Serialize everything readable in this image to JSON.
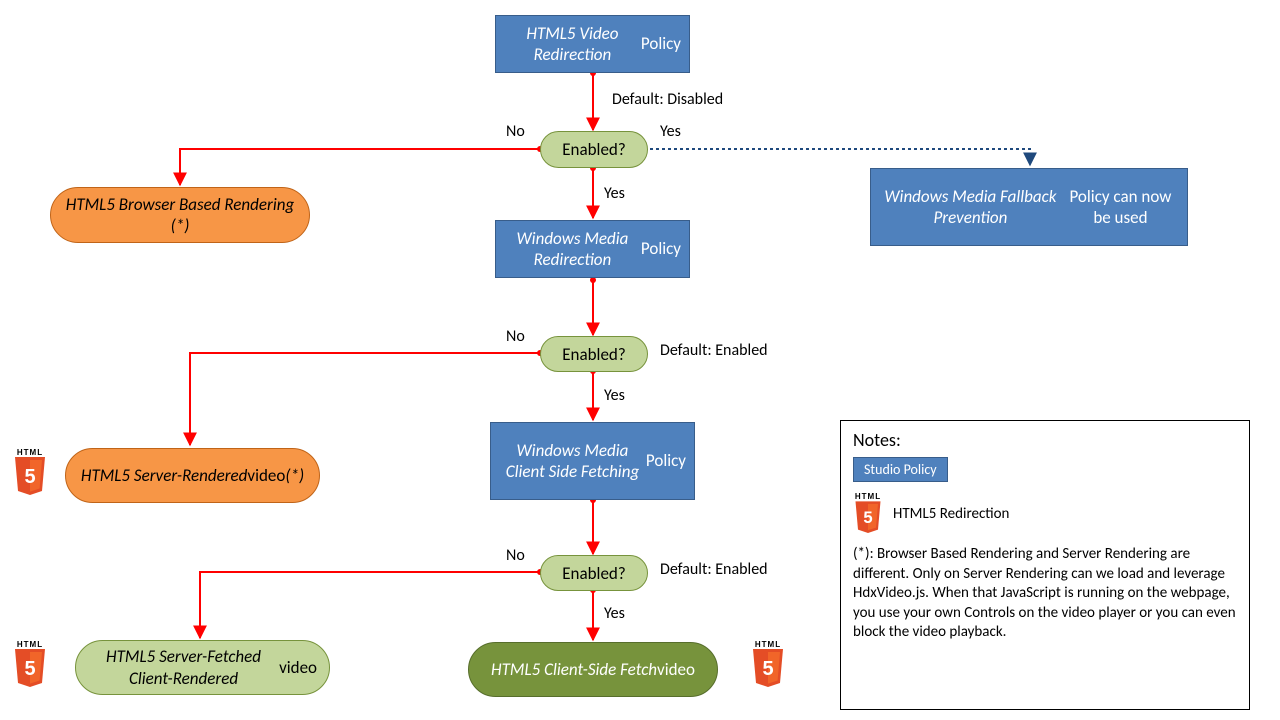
{
  "nodes": {
    "policy1_html": "<span class='em'>HTML5 Video Redirection</span> Policy",
    "policy2_html": "<span class='em'>Windows Media Redirection</span> Policy",
    "policy3_html": "<span class='em'>Windows Media Client Side Fetching</span> Policy",
    "fallback_html": "<span class='em'>Windows Media Fallback Prevention</span> Policy can now be used",
    "decision": "Enabled?",
    "outcome_orange1": "HTML5 Browser Based Rendering (*)",
    "outcome_orange2_html": "HTML5 Server-Rendered <span class='normal'>video</span> (*)",
    "outcome_lime_html": "HTML5 Server-Fetched Client-Rendered <span class='normal'>video</span>",
    "outcome_green_html": "HTML5 Client-Side Fetch <span class='normal'>video</span>"
  },
  "labels": {
    "default_disabled": "Default: Disabled",
    "default_enabled": "Default: Enabled",
    "yes": "Yes",
    "no": "No"
  },
  "notes": {
    "title": "Notes:",
    "studio_policy": "Studio Policy",
    "html5_redir": "HTML5 Redirection",
    "footnote": "(*): Browser Based Rendering and Server Rendering are different. Only on Server Rendering can we load and leverage HdxVideo.js. When that JavaScript is running on the webpage, you use your own Controls on the video player or you can even block the video playback."
  }
}
